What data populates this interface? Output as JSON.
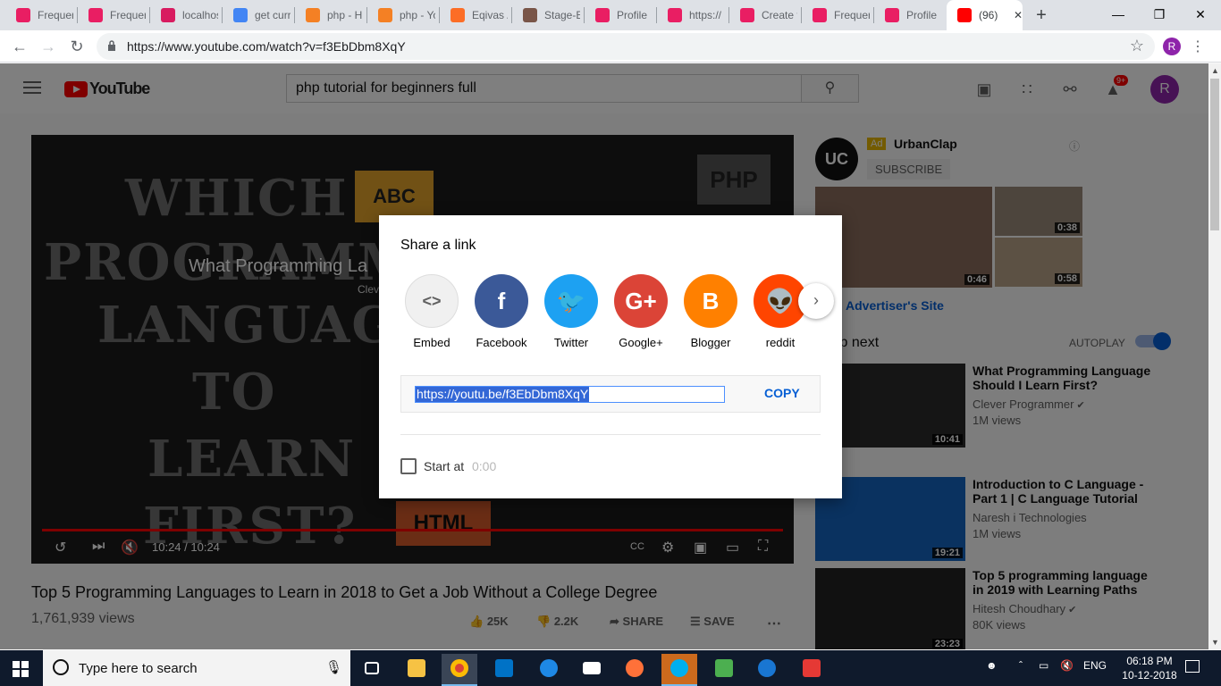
{
  "browser": {
    "tabs": [
      {
        "label": "Frequer",
        "icon": "p-icon",
        "color": "#e91e63"
      },
      {
        "label": "Frequer",
        "icon": "p-icon",
        "color": "#e91e63"
      },
      {
        "label": "localhos",
        "icon": "db-icon",
        "color": "#d81b60"
      },
      {
        "label": "get curr",
        "icon": "google-icon",
        "color": "#4285f4"
      },
      {
        "label": "php - H",
        "icon": "stack-icon",
        "color": "#f48024"
      },
      {
        "label": "php - Yo",
        "icon": "stack-icon",
        "color": "#f48024"
      },
      {
        "label": "Eqivas /",
        "icon": "gitlab-icon",
        "color": "#fc6d26"
      },
      {
        "label": "Stage-E",
        "icon": "avatar-icon",
        "color": "#795548"
      },
      {
        "label": "Profile",
        "icon": "p-icon",
        "color": "#e91e63"
      },
      {
        "label": "https://",
        "icon": "p-icon",
        "color": "#e91e63"
      },
      {
        "label": "Create t",
        "icon": "p-icon",
        "color": "#e91e63"
      },
      {
        "label": "Frequer",
        "icon": "p-icon",
        "color": "#e91e63"
      },
      {
        "label": "Profile",
        "icon": "p-icon",
        "color": "#e91e63"
      },
      {
        "label": "(96)",
        "icon": "youtube-icon",
        "color": "#ff0000"
      }
    ],
    "close_glyph": "✕",
    "new_tab": "+",
    "url": "https://www.youtube.com/watch?v=f3EbDbm8XqY",
    "profile_initial": "R"
  },
  "youtube": {
    "logo_text": "YouTube",
    "search_value": "php tutorial for beginners full",
    "notification_count": "9+",
    "avatar_initial": "R",
    "player": {
      "overlay_words": [
        "WHICH",
        "PROGRAMMING",
        "LANGUAGE",
        "TO",
        "LEARN",
        "FIRST?"
      ],
      "overlay_title": "What Programming La",
      "overlay_channel": "Clev",
      "box_abc": "ABC",
      "box_php": "PHP",
      "box_html": "HTML",
      "time": "10:24 / 10:24"
    },
    "video_title": "Top 5 Programming Languages to Learn in 2018 to Get a Job Without a College Degree",
    "views": "1,761,939 views",
    "likes": "25K",
    "dislikes": "2.2K",
    "share_label": "SHARE",
    "save_label": "SAVE",
    "ad": {
      "logo": "UC",
      "badge": "Ad",
      "name": "UrbanClap",
      "subscribe": "SUBSCRIBE",
      "durations": [
        "0:46",
        "0:38",
        "0:58"
      ],
      "advertiser_site": "Advertiser's Site"
    },
    "up_next": "Up next",
    "autoplay": "AUTOPLAY",
    "recommendations": [
      {
        "title": "What Programming Language Should I Learn First?",
        "channel": "Clever Programmer",
        "verified": true,
        "views": "1M views",
        "duration": "10:41",
        "thumb_color": "#2a2a2a"
      },
      {
        "title": "Introduction to C Language - Part 1 | C Language Tutorial",
        "channel": "Naresh i Technologies",
        "verified": false,
        "views": "1M views",
        "duration": "19:21",
        "thumb_color": "#1565c0"
      },
      {
        "title": "Top 5 programming language in 2019 with Learning Paths",
        "channel": "Hitesh Choudhary",
        "verified": true,
        "views": "80K views",
        "duration": "23:23",
        "thumb_color": "#222222"
      }
    ]
  },
  "share_dialog": {
    "title": "Share a link",
    "items": [
      {
        "label": "Embed",
        "icon": "embed-icon",
        "color": "#f0f0f0",
        "glyph": "<>"
      },
      {
        "label": "Facebook",
        "icon": "facebook-icon",
        "color": "#3b5998",
        "glyph": "f"
      },
      {
        "label": "Twitter",
        "icon": "twitter-icon",
        "color": "#1da1f2",
        "glyph": "🐦"
      },
      {
        "label": "Google+",
        "icon": "google-plus-icon",
        "color": "#db4437",
        "glyph": "G+"
      },
      {
        "label": "Blogger",
        "icon": "blogger-icon",
        "color": "#ff8000",
        "glyph": "B"
      },
      {
        "label": "reddit",
        "icon": "reddit-icon",
        "color": "#ff4500",
        "glyph": "👽"
      }
    ],
    "link": "https://youtu.be/f3EbDbm8XqY",
    "copy_label": "COPY",
    "start_at_label": "Start at",
    "start_time": "0:00"
  },
  "taskbar": {
    "search_placeholder": "Type here to search",
    "lang": "ENG",
    "time": "06:18 PM",
    "date": "10-12-2018"
  }
}
